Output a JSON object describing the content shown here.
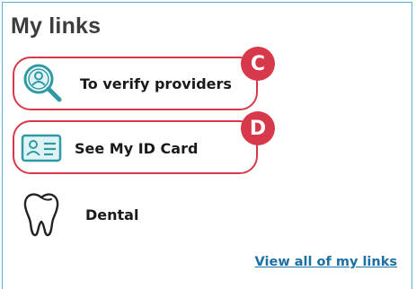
{
  "panel": {
    "title": "My links",
    "border_color": "#5aaed6"
  },
  "links": [
    {
      "label": "To verify providers",
      "icon": "search-person-icon",
      "callout": "C"
    },
    {
      "label": "See My ID Card",
      "icon": "id-card-icon",
      "callout": "D"
    },
    {
      "label": "Dental",
      "icon": "tooth-icon"
    }
  ],
  "footer": {
    "view_all_label": "View all of my links"
  },
  "colors": {
    "callout": "#d8394a",
    "icon_teal": "#2f9aa5",
    "link_blue": "#1c6fa3"
  }
}
